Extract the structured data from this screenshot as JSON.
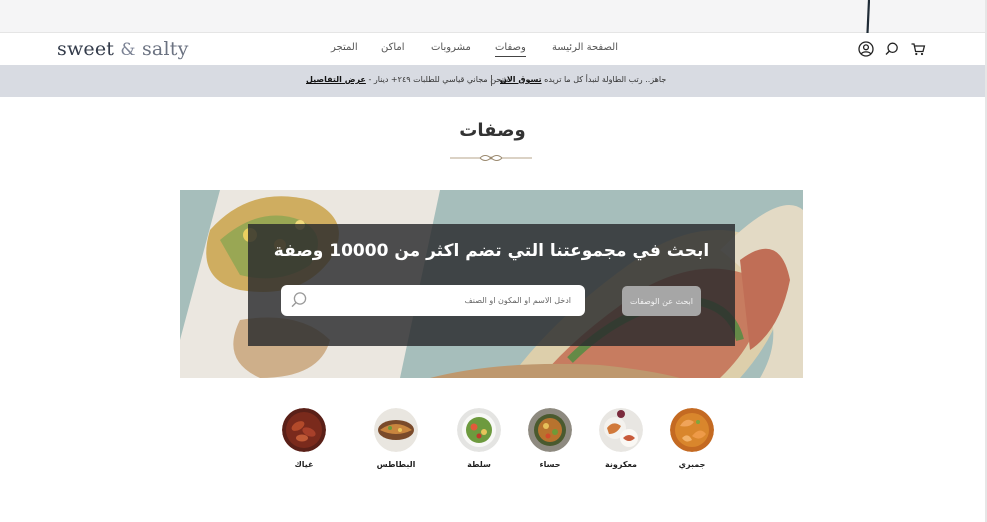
{
  "header": {
    "logo": {
      "sweet": "sweet",
      "amp": "&",
      "salty": "salty"
    },
    "nav": [
      {
        "label": "الصفحة الرئيسة",
        "active": false
      },
      {
        "label": "وصفات",
        "active": true
      },
      {
        "label": "مشروبات",
        "active": false
      },
      {
        "label": "اماكن",
        "active": false
      },
      {
        "label": "المتجر",
        "active": false
      }
    ],
    "icons": [
      "user-icon",
      "search-icon",
      "cart-icon"
    ]
  },
  "promo": {
    "left_text": "شحن مجاني قياسي للطلبات ٢٤٩+ دينار -",
    "left_link": "عرض التفاصيل",
    "right_text": "جاهز.. رتب الطاولة لنبدأ كل ما تريده",
    "right_link": "تسوق الان"
  },
  "page_title": "وصفات",
  "search": {
    "heading": "ابحث في مجموعتنا التي تضم اكثر من 10000 وصفة",
    "placeholder": "ادخل الاسم او المكون او الصنف",
    "button": "ابحث عن الوصفات"
  },
  "categories": [
    {
      "label": "جمبري",
      "icon": "shrimp-dish-image"
    },
    {
      "label": "معكرونة",
      "icon": "pasta-dish-image"
    },
    {
      "label": "حساء",
      "icon": "soup-bowl-image"
    },
    {
      "label": "سلطة",
      "icon": "salad-bowl-image"
    },
    {
      "label": "البطاطس",
      "icon": "potato-dish-image"
    },
    {
      "label": "غياك",
      "icon": "sausage-dish-image"
    }
  ],
  "colors": {
    "promo_bg": "#d8dbe2",
    "overlay": "#2a2c2e",
    "button_bg": "#a6a6a6",
    "logo": "#333b4a"
  }
}
